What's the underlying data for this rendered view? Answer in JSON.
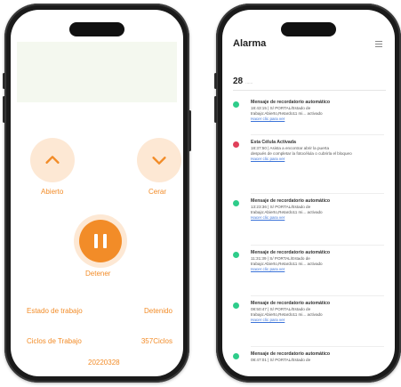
{
  "control_screen": {
    "open_label": "Abierto",
    "close_label": "Cerar",
    "stop_label": "Detener",
    "work_state_label": "Estado de trabajo",
    "work_state_value": "Detenido",
    "cycles_label": "Ciclos de Trabajo",
    "cycles_value": "357Ciclos",
    "date_code": "20220328",
    "accent_color": "#f28c28"
  },
  "alarm_screen": {
    "title": "Alarma",
    "date": "28",
    "date_sub": "......",
    "notifications": [
      {
        "color": "#2ecc8a",
        "title": "Mensaje de recordatorio automático",
        "line1": "18:43:15 | S/ PORTAL/Estado de",
        "line2": "trabajo:Abierto,Retardo11 mi... activado",
        "link": "Hacer clic para ver"
      },
      {
        "color": "#e0405a",
        "title": "Esta Célula Activada",
        "line1": "18:37:50 | Asista a encontrar abrir la puerta",
        "line2": "después de completar la fotocélula o cubrirla el bloqueo",
        "link": "Hacer clic para ver"
      },
      {
        "color": "#2ecc8a",
        "title": "Mensaje de recordatorio automático",
        "line1": "13:23:36 | S/ PORTAL/Estado de",
        "line2": "trabajo:Abierto,Retardo11 mi... activado",
        "link": "Hacer clic para ver"
      },
      {
        "color": "#2ecc8a",
        "title": "Mensaje de recordatorio automático",
        "line1": "11:31:39 | S/ PORTAL/Estado de",
        "line2": "trabajo:Abierto,Retardo11 mi... activado",
        "link": "Hacer clic para ver"
      },
      {
        "color": "#2ecc8a",
        "title": "Mensaje de recordatorio automático",
        "line1": "08:50:47 | S/ PORTAL/Estado de",
        "line2": "trabajo:Abierto,Retardo11 mi... activado",
        "link": "Hacer clic para ver"
      },
      {
        "color": "#2ecc8a",
        "title": "Mensaje de recordatorio automático",
        "line1": "08:47:01 | S/ PORTAL/Estado de",
        "line2": "",
        "link": ""
      }
    ]
  }
}
